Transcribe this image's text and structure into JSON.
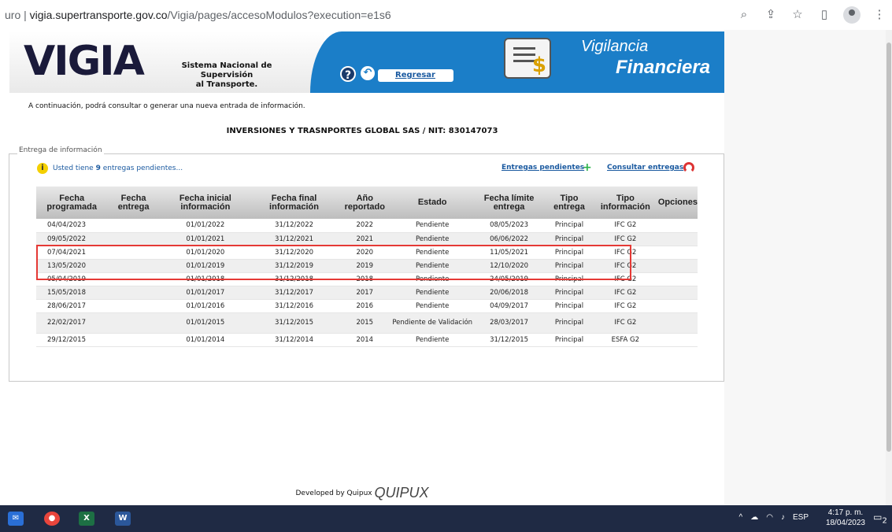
{
  "browser": {
    "url_prefix": "uro",
    "url_host": "vigia.supertransporte.gov.co",
    "url_path": "/Vigia/pages/accesoModulos?execution=e1s6"
  },
  "header": {
    "logo_text": "VIGIA",
    "logo_subtitle_1": "Sistema Nacional de Supervisión",
    "logo_subtitle_2": "al Transporte.",
    "regresar_label": "Regresar",
    "module_title_1": "Vigilancia",
    "module_title_2": "Financiera"
  },
  "intro_text": "A continuación, podrá consultar o generar una nueva entrada de información.",
  "company_line": "INVERSIONES Y TRASNPORTES GLOBAL SAS / NIT: 830147073",
  "section_legend": "Entrega de información",
  "pending_note_prefix": "Usted tiene",
  "pending_count": "9",
  "pending_note_suffix": "entregas pendientes...",
  "links": {
    "pendientes": "Entregas pendientes",
    "consultar": "Consultar entregas"
  },
  "table": {
    "columns": [
      "Fecha programada",
      "Fecha entrega",
      "Fecha inicial información",
      "Fecha final información",
      "Año reportado",
      "Estado",
      "Fecha límite entrega",
      "Tipo entrega",
      "Tipo información",
      "Opciones"
    ],
    "rows": [
      [
        "04/04/2023",
        "",
        "01/01/2022",
        "31/12/2022",
        "2022",
        "Pendiente",
        "08/05/2023",
        "Principal",
        "IFC G2",
        ""
      ],
      [
        "09/05/2022",
        "",
        "01/01/2021",
        "31/12/2021",
        "2021",
        "Pendiente",
        "06/06/2022",
        "Principal",
        "IFC G2",
        ""
      ],
      [
        "07/04/2021",
        "",
        "01/01/2020",
        "31/12/2020",
        "2020",
        "Pendiente",
        "11/05/2021",
        "Principal",
        "IFC G2",
        ""
      ],
      [
        "13/05/2020",
        "",
        "01/01/2019",
        "31/12/2019",
        "2019",
        "Pendiente",
        "12/10/2020",
        "Principal",
        "IFC G2",
        ""
      ],
      [
        "05/04/2019",
        "",
        "01/01/2018",
        "31/12/2018",
        "2018",
        "Pendiente",
        "24/05/2019",
        "Principal",
        "IFC G2",
        ""
      ],
      [
        "15/05/2018",
        "",
        "01/01/2017",
        "31/12/2017",
        "2017",
        "Pendiente",
        "20/06/2018",
        "Principal",
        "IFC G2",
        ""
      ],
      [
        "28/06/2017",
        "",
        "01/01/2016",
        "31/12/2016",
        "2016",
        "Pendiente",
        "04/09/2017",
        "Principal",
        "IFC G2",
        ""
      ],
      [
        "22/02/2017",
        "",
        "01/01/2015",
        "31/12/2015",
        "2015",
        "Pendiente de Validación",
        "28/03/2017",
        "Principal",
        "IFC G2",
        ""
      ],
      [
        "29/12/2015",
        "",
        "01/01/2014",
        "31/12/2014",
        "2014",
        "Pendiente",
        "31/12/2015",
        "Principal",
        "ESFA G2",
        ""
      ]
    ]
  },
  "footer": {
    "developed_by": "Developed by Quipux",
    "brand": "QUIPUX"
  },
  "taskbar": {
    "language": "ESP",
    "time": "4:17 p. m.",
    "date": "18/04/2023",
    "notification_count": "2"
  }
}
